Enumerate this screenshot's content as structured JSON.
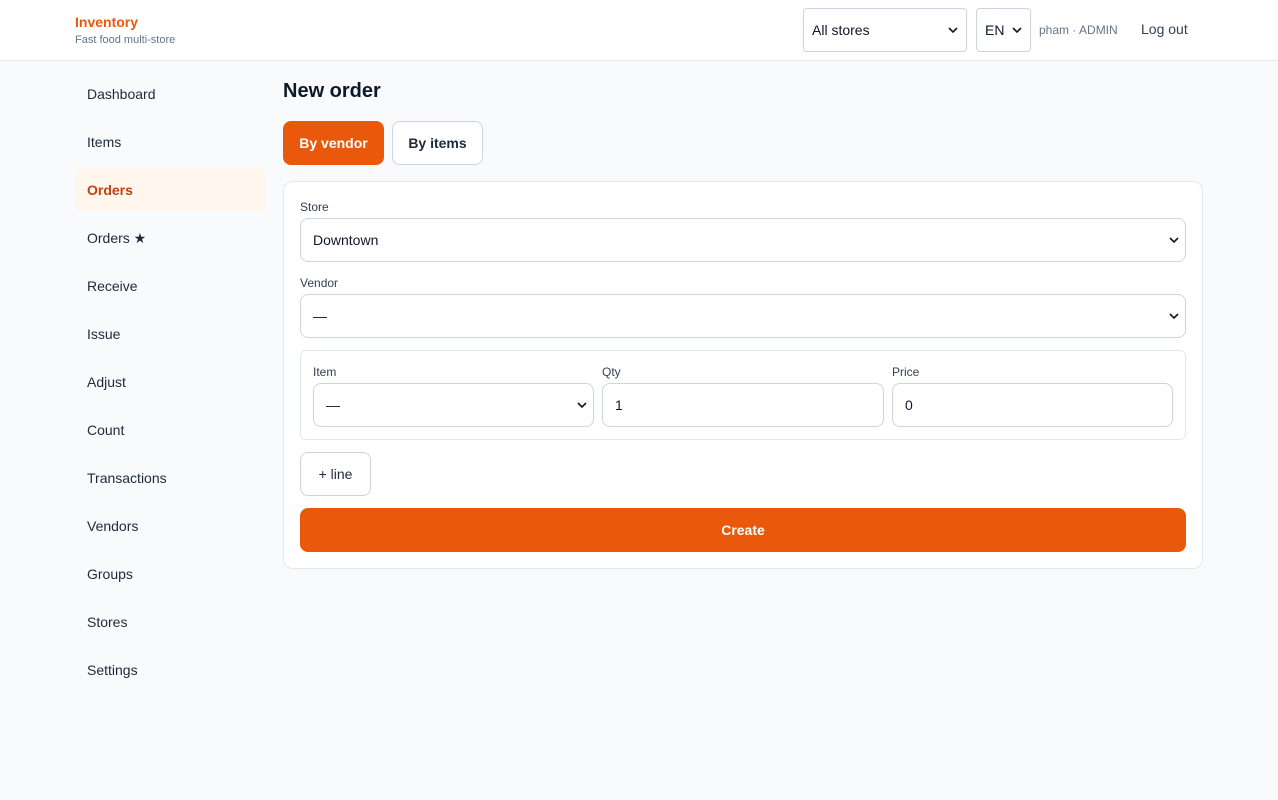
{
  "brand": {
    "title": "Inventory",
    "subtitle": "Fast food multi-store"
  },
  "header": {
    "store_filter": "All stores",
    "language": "EN",
    "user": "pham · ADMIN",
    "logout_label": "Log out"
  },
  "sidebar": {
    "items": [
      {
        "label": "Dashboard",
        "active": false
      },
      {
        "label": "Items",
        "active": false
      },
      {
        "label": "Orders",
        "active": true
      },
      {
        "label": "Orders ★",
        "active": false
      },
      {
        "label": "Receive",
        "active": false
      },
      {
        "label": "Issue",
        "active": false
      },
      {
        "label": "Adjust",
        "active": false
      },
      {
        "label": "Count",
        "active": false
      },
      {
        "label": "Transactions",
        "active": false
      },
      {
        "label": "Vendors",
        "active": false
      },
      {
        "label": "Groups",
        "active": false
      },
      {
        "label": "Stores",
        "active": false
      },
      {
        "label": "Settings",
        "active": false
      }
    ]
  },
  "main": {
    "title": "New order",
    "tabs": [
      {
        "label": "By vendor",
        "active": true
      },
      {
        "label": "By items",
        "active": false
      }
    ],
    "form": {
      "store_label": "Store",
      "store_value": "Downtown",
      "vendor_label": "Vendor",
      "vendor_value": "—",
      "item_label": "Item",
      "item_value": "—",
      "qty_label": "Qty",
      "qty_value": "1",
      "price_label": "Price",
      "price_value": "0",
      "add_line_label": "+ line",
      "create_label": "Create"
    }
  },
  "colors": {
    "accent": "#ea580c",
    "active_bg": "#fff7ed",
    "active_text": "#c2410c"
  }
}
